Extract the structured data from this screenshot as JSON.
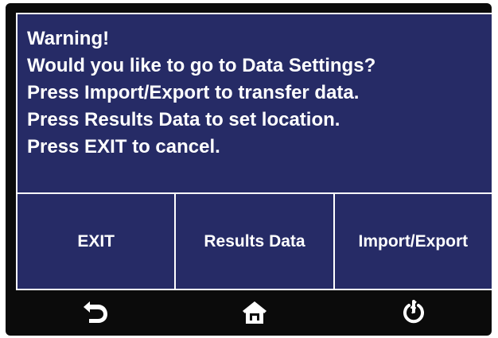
{
  "dialog": {
    "lines": [
      "Warning!",
      "Would you like to go to Data Settings?",
      "Press Import/Export to transfer data.",
      "Press Results Data to set location.",
      "Press EXIT to cancel."
    ]
  },
  "buttons": {
    "exit_label": "EXIT",
    "results_label": "Results Data",
    "import_export_label": "Import/Export"
  },
  "navbar": {
    "icons": [
      "back-icon",
      "home-icon",
      "power-icon"
    ]
  },
  "colors": {
    "panel_background": "#262b66",
    "screen_background": "#0b0b0b",
    "text": "#ffffff"
  }
}
